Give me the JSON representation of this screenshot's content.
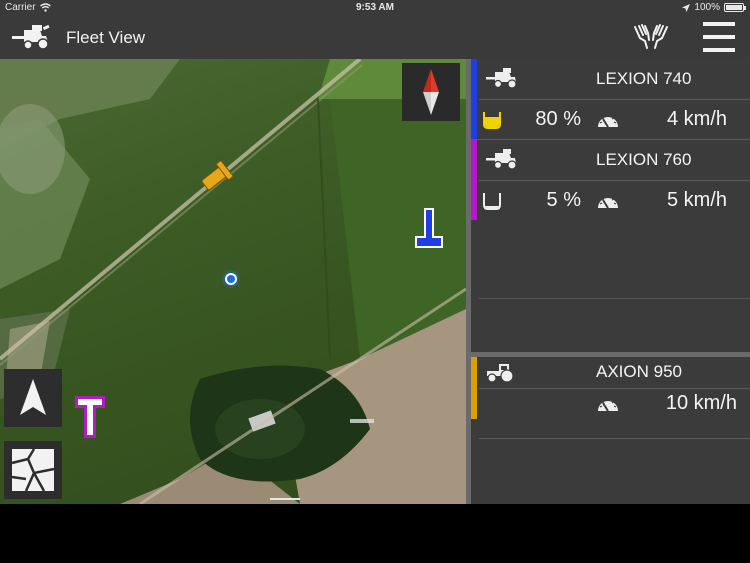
{
  "status_bar": {
    "carrier": "Carrier",
    "time": "9:53 AM",
    "battery": "100%"
  },
  "nav": {
    "title": "Fleet View"
  },
  "colors": {
    "lexion740": "#1f3fe0",
    "lexion760": "#b419c8",
    "axion950": "#d9a000",
    "fill_yellow": "#f0d400",
    "location_blue": "#1a6fe0"
  },
  "vehicles": [
    {
      "name": "LEXION 740",
      "fill": "80 %",
      "speed": "4 km/h",
      "type_icon": "combine-harvester-icon"
    },
    {
      "name": "LEXION 760",
      "fill": "5 %",
      "speed": "5 km/h",
      "type_icon": "combine-harvester-icon"
    },
    {
      "name": "AXION 950",
      "speed": "10 km/h",
      "type_icon": "tractor-icon"
    }
  ]
}
